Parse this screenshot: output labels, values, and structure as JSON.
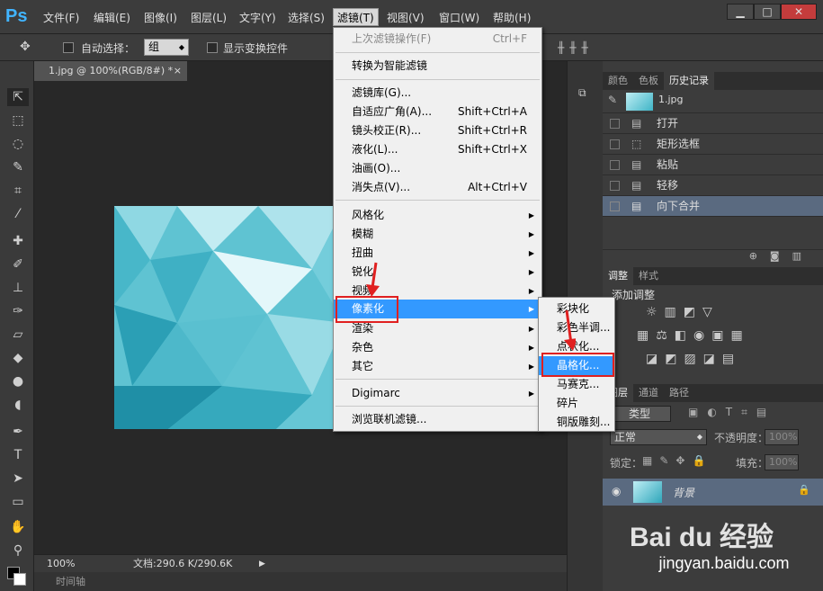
{
  "app": {
    "logo": "Ps"
  },
  "menubar": {
    "items": [
      "文件(F)",
      "编辑(E)",
      "图像(I)",
      "图层(L)",
      "文字(Y)",
      "选择(S)",
      "滤镜(T)",
      "视图(V)",
      "窗口(W)",
      "帮助(H)"
    ]
  },
  "window_buttons": {
    "minimize": "▁",
    "maximize": "□",
    "close": "✕"
  },
  "options": {
    "auto_select_label": "自动选择：",
    "auto_select_value": "组",
    "show_transform_label": "显示变换控件"
  },
  "document": {
    "tab_title": "1.jpg @ 100%(RGB/8#) *",
    "tab_close": "×"
  },
  "status": {
    "zoom": "100%",
    "doc_info": "文档:290.6 K/290.6K"
  },
  "timeline": {
    "label": "时间轴"
  },
  "history_panel": {
    "tabs": [
      "颜色",
      "色板",
      "历史记录"
    ],
    "snapshot": "1.jpg",
    "items": [
      "打开",
      "矩形选框",
      "粘贴",
      "轻移",
      "向下合并"
    ]
  },
  "adjust_panel": {
    "tabs": [
      "调整",
      "样式"
    ],
    "title": "添加调整"
  },
  "layers_panel": {
    "tabs": [
      "图层",
      "通道",
      "路径"
    ],
    "kind_label": "类型",
    "blend_mode": "正常",
    "opacity_label": "不透明度：",
    "opacity_value": "100%",
    "lock_label": "锁定：",
    "fill_label": "填充：",
    "fill_value": "100%",
    "layer_name": "背景"
  },
  "filter_menu": {
    "last_filter": "上次滤镜操作(F)",
    "last_filter_sc": "Ctrl+F",
    "smart": "转换为智能滤镜",
    "gallery": "滤镜库(G)...",
    "adaptive": "自适应广角(A)...",
    "adaptive_sc": "Shift+Ctrl+A",
    "lens": "镜头校正(R)...",
    "lens_sc": "Shift+Ctrl+R",
    "liquify": "液化(L)...",
    "liquify_sc": "Shift+Ctrl+X",
    "oil": "油画(O)...",
    "vanish": "消失点(V)...",
    "vanish_sc": "Alt+Ctrl+V",
    "stylize": "风格化",
    "blur": "模糊",
    "distort": "扭曲",
    "sharpen": "锐化",
    "video": "视频",
    "pixelate": "像素化",
    "render": "渲染",
    "noise": "杂色",
    "other": "其它",
    "digimarc": "Digimarc",
    "browse": "浏览联机滤镜..."
  },
  "pixelate_submenu": {
    "items": [
      "彩块化",
      "彩色半调...",
      "点状化...",
      "晶格化...",
      "马赛克...",
      "碎片",
      "铜版雕刻..."
    ]
  },
  "watermark": {
    "text": "Bai du 经验",
    "url": "jingyan.baidu.com"
  }
}
